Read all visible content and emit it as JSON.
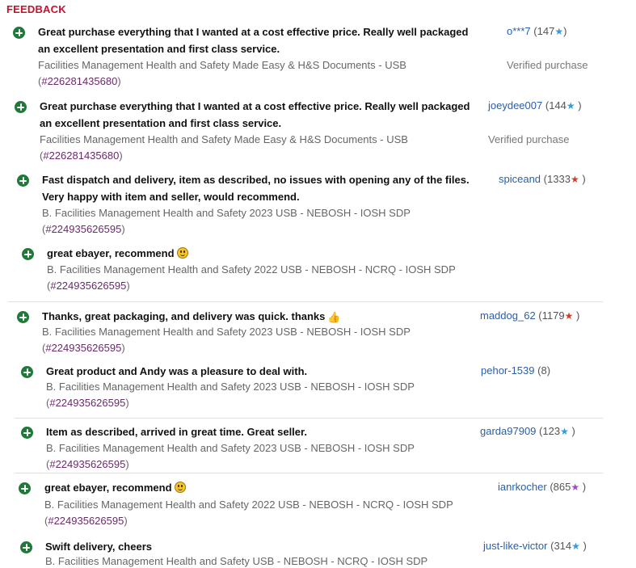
{
  "header": {
    "title": "FEEDBACK"
  },
  "entries": [
    {
      "comment_lines": [
        "Great purchase everything that I wanted at a cost effective price. Really well packaged",
        "an excellent presentation and first class service."
      ],
      "item": "Facilities Management Health and Safety Made Easy & H&S Documents - USB",
      "item_id": "#226281435680",
      "user": "o***7",
      "score": "147",
      "star": "★",
      "star_color": "blue",
      "verified": "Verified purchase"
    },
    {
      "comment_lines": [
        "Great purchase everything that I wanted at a cost effective price. Really well packaged",
        "an excellent presentation and first class service."
      ],
      "item": "Facilities Management Health and Safety Made Easy & H&S Documents - USB",
      "item_id": "#226281435680",
      "user": "joeydee007",
      "score": "144",
      "star": "★",
      "star_color": "blue",
      "verified": "Verified purchase"
    },
    {
      "comment_lines": [
        "Fast dispatch and delivery, item as described, no issues with opening any of the files.",
        "Very happy with item and seller, would recommend."
      ],
      "item": "B. Facilities Management Health and Safety 2023 USB - NEBOSH - IOSH SDP",
      "item_id": "#224935626595",
      "user": "spiceand",
      "score": "1333",
      "star": "★",
      "star_color": "red"
    },
    {
      "comment_lines": [
        "great ebayer, recommend"
      ],
      "item": "B. Facilities Management Health and Safety 2022 USB - NEBOSH - NCRQ - IOSH SDP",
      "item_id": "#224935626595"
    },
    {
      "comment_lines": [
        "Thanks, great packaging, and delivery was quick. thanks"
      ],
      "item": "B. Facilities Management Health and Safety 2023 USB - NEBOSH - IOSH SDP",
      "item_id": "#224935626595",
      "user": "maddog_62",
      "score": "1179",
      "star": "★",
      "star_color": "red"
    },
    {
      "comment_lines": [
        "Great product and Andy was a pleasure to deal with."
      ],
      "item": "B. Facilities Management Health and Safety 2023 USB - NEBOSH - IOSH SDP",
      "item_id": "#224935626595",
      "user": "pehor-1539",
      "score": "8"
    },
    {
      "comment_lines": [
        "Item as described, arrived in great time. Great seller."
      ],
      "item": "B. Facilities Management Health and Safety 2023 USB - NEBOSH - IOSH SDP",
      "item_id": "#224935626595",
      "user": "garda97909",
      "score": "123",
      "star": "★",
      "star_color": "blue"
    },
    {
      "comment_lines": [
        "great ebayer, recommend"
      ],
      "item": "B. Facilities Management Health and Safety 2022 USB - NEBOSH - NCRQ - IOSH SDP",
      "item_id": "#224935626595",
      "user": "ianrkocher",
      "score": "865",
      "star": "★",
      "star_color": "purple"
    },
    {
      "comment_lines": [
        "Swift delivery, cheers"
      ],
      "item": "B. Facilities Management Health and Safety USB - NEBOSH - NCRQ - IOSH SDP",
      "user": "just-like-victor",
      "score": "314",
      "star": "★",
      "star_color": "blue"
    }
  ]
}
